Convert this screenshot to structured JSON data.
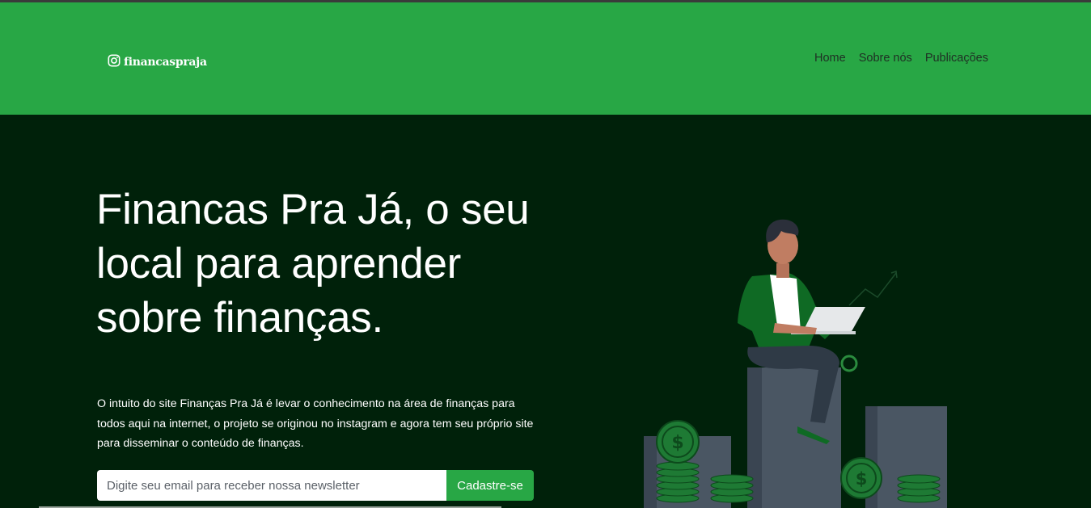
{
  "header": {
    "brand": {
      "icon": "instagram-icon",
      "text": "financaspraja"
    },
    "nav": [
      {
        "label": "Home"
      },
      {
        "label": "Sobre nós"
      },
      {
        "label": "Publicações"
      }
    ]
  },
  "hero": {
    "title": "Financas Pra Já, o seu local para aprender sobre finanças.",
    "description": "O intuito do site Finanças Pra Já é levar o conhecimento na área de finanças para todos aqui na internet, o projeto se originou no instagram e agora tem seu próprio site para disseminar o conteúdo de finanças.",
    "newsletter": {
      "placeholder": "Digite seu email para receber nossa newsletter",
      "button": "Cadastre-se"
    },
    "illustration_icon": "person-with-laptop-on-money-illustration"
  },
  "colors": {
    "header_bg": "#28a745",
    "page_bg": "#00210a",
    "accent": "#28a745"
  }
}
